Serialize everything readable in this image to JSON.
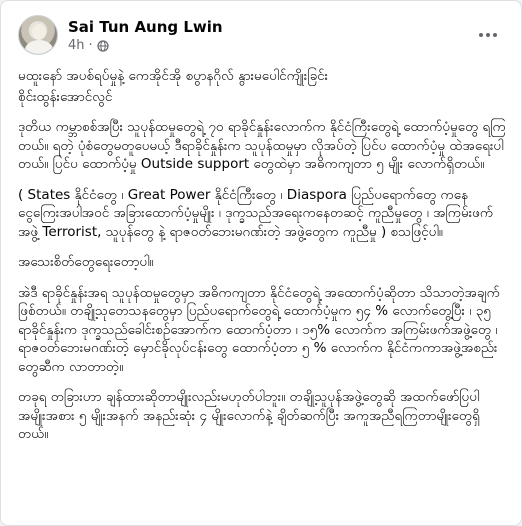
{
  "post": {
    "author": "Sai Tun Aung Lwin",
    "time": "4h",
    "dot": "·",
    "privacy_icon": "globe-icon",
    "more_icon": "more-options-icon"
  },
  "paragraphs": [
    "မထူးနော် အပစ်ရပ်မှုနဲ့ ကေအိုင်အို စပွာနဂိုလ် နွားမပေါင်ကျိုးခြင်း",
    "စိုင်းထွန်းအောင်လွင်",
    "ဒုတိယ ကမ္ဘာစစ်အပြီး သူပုန်ထမှုတွေရဲ့ ၇၀ ရာခိုင်နှုန်းလောက်က နိုင်ငံကြီးတွေရဲ့ ထောက်ပံ့မှုတွေ ရကြတယ်။ ရတဲ့ ပုံစံတွေမတူပေမယ့် ဒီရာခိုင်နှုန်းက သူပုန်ထမှုမှာ လိုအပ်တဲ့ ပြင်ပ ထောက်ပံ့မှု ထဲအရေးပါတယ်။ ပြင်ပ ထောက်ပံ့မှု Outside support တွေထဲမှာ အဓိကကျတာ ၅ မျိုး လောက်ရှိတယ်။",
    "( States နိုင်ငံတွေ ၊ Great Power နိုင်ငံကြီးတွေ ၊ Diaspora ပြည်ပရောက်တွေ ကနေ ငွေကြေးအပါအဝင် အခြားထောက်ပံ့မှုမျိုး ၊ ဒုက္ခသည်အရေးကနေတဆင့် ကူညီမှုတွေ ၊ အကြမ်းဖက်အဖွဲ့ Terrorist, သူပုန်တွေ နဲ့ ရာဇဝတ်ဘေးမဂဏ်းတဲ့ အဖွဲ့တွေက ကူညီမှု ) စသဖြင့်ပါ။",
    "အသေးစိတ်တွေရေးတော့ပါ။",
    "အဲဒီ ရာခိုင်နှုန်းအရ သူပုန်ထမှုတွေမှာ အဓိကကျတာ နိုင်ငံတွေရဲ့ အထောက်ပံ့ဆိုတာ သိသာတဲ့အချက်ဖြစ်တယ်။ တချို့သုတေသနတွေမှာ ပြည်ပရောက်တွေရဲ့ ထောက်ပံ့မှုက ၅၄ % လောက်တွေ့ပြီး ၊ ၃၅ ရာခိုင်နှုန်းက ဒုက္ခသည်ခေါင်းစဉ်အောက်က ထောက်ပံ့တာ ၊ ၁၅% လောက်က အကြမ်းဖက်အဖွဲ့တွေ ၊ ရာဇဝတ်ဘေးမဂဏ်းတဲ့ မှောင်ခိုလုပ်ငန်းတွေ ထောက်ပံ့တာ ၅ % လောက်က နိုင်ငံကကာအဖွဲ့အစည်းတွေဆီက လာတာတဲ့။",
    "တခုရ တခြားဟာ ချန်ထားဆိုတာမျိုးလည်းမဟုတ်ပါဘူး။ တချို့သူပုန်အဖွဲ့တွေဆို အထက်ဖော်ပြပါ အမျိုးအစား ၅ မျိုးအနက် အနည်းဆုံး ၄ မျိုးလောက်နဲ့ ချိတ်ဆက်ပြီး အကူအညီရကြတာမျိုးတွေရှိတယ်။"
  ]
}
